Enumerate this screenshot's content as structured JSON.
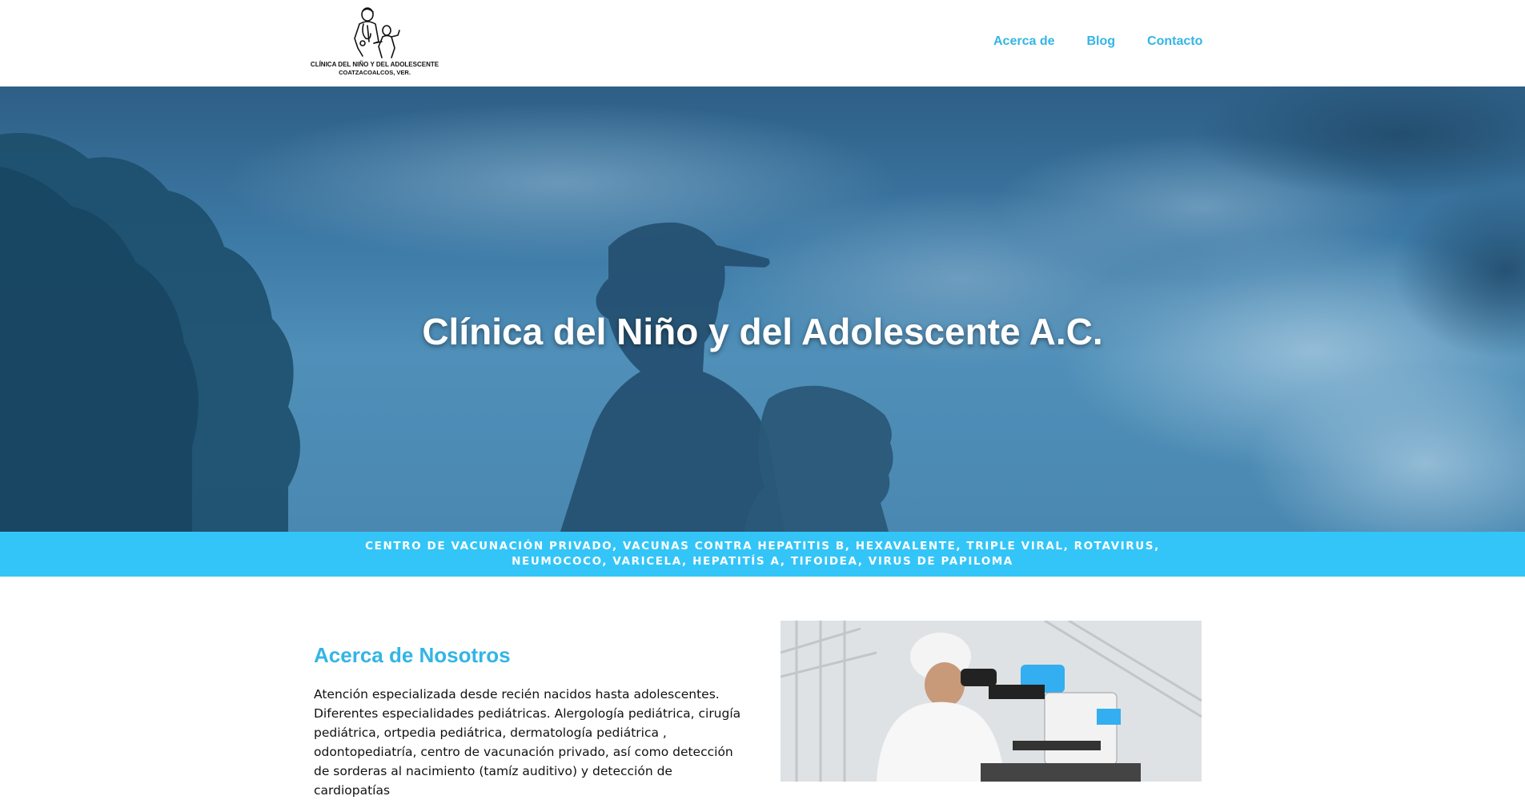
{
  "header": {
    "logo": {
      "line1": "CLÍNICA DEL NIÑO Y DEL ADOLESCENTE",
      "line2": "COATZACOALCOS, VER."
    },
    "nav": [
      {
        "label": "Acerca de"
      },
      {
        "label": "Blog"
      },
      {
        "label": "Contacto"
      }
    ]
  },
  "hero": {
    "title": "Clínica del Niño y del Adolescente A.C."
  },
  "banner": {
    "text": "CENTRO DE VACUNACIÓN PRIVADO, VACUNAS CONTRA HEPATITIS B, HEXAVALENTE, TRIPLE VIRAL, ROTAVIRUS, NEUMOCOCO, VARICELA, HEPATITÍS A, TIFOIDEA, VIRUS DE PAPILOMA"
  },
  "about": {
    "title": "Acerca de Nosotros",
    "text": "Atención especializada desde recién nacidos hasta adolescentes. Diferentes especialidades pediátricas. Alergología pediátrica, cirugía pediátrica, ortpedia pediátrica, dermatología pediátrica , odontopediatría, centro de vacunación privado, así como detección de sorderas al nacimiento (tamíz auditivo) y detección de cardiopatías"
  },
  "colors": {
    "accent": "#33b5e5",
    "banner": "#33c5f8",
    "hero_overlay": "#3d7aa6"
  }
}
